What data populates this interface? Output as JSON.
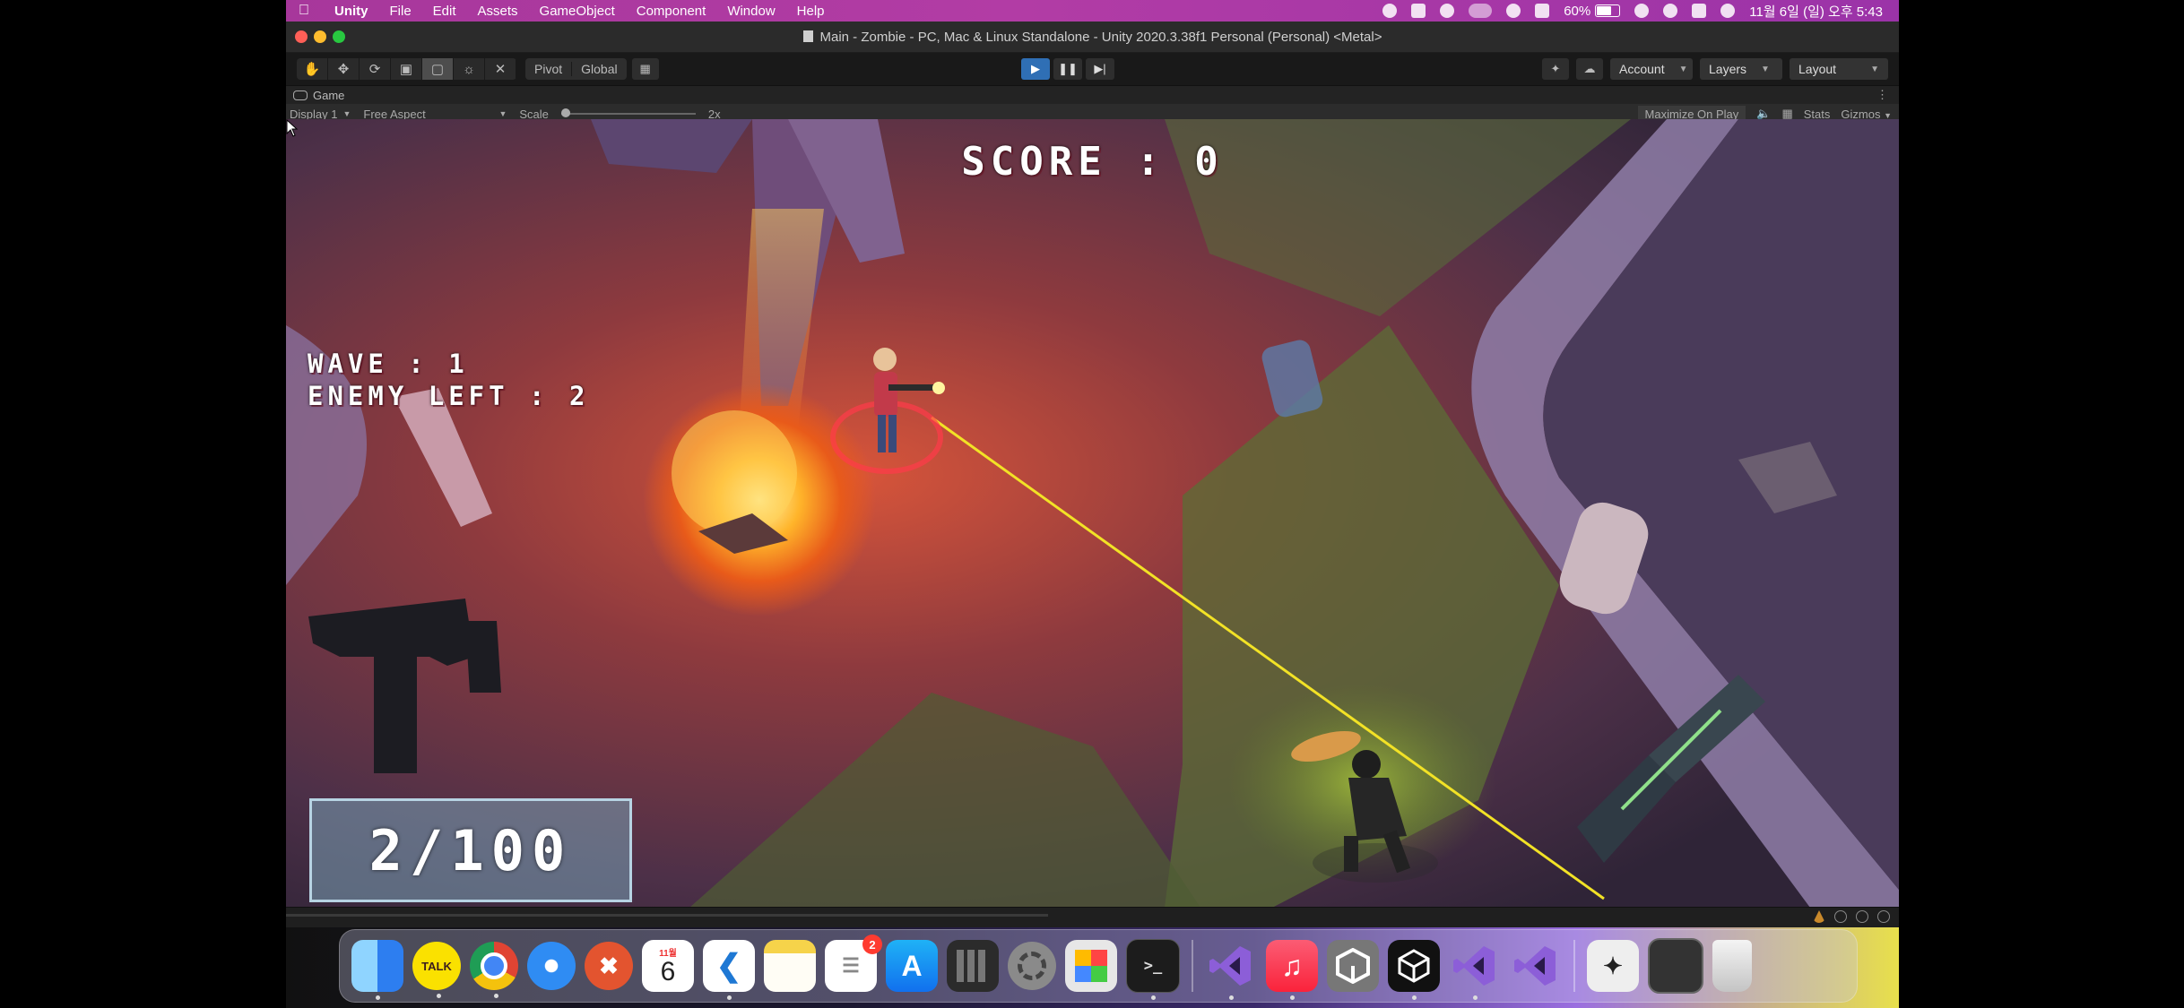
{
  "menubar": {
    "apple": "",
    "items": [
      "Unity",
      "File",
      "Edit",
      "Assets",
      "GameObject",
      "Component",
      "Window",
      "Help"
    ],
    "battery": "60%",
    "datetime": "11월 6일 (일) 오후 5:43",
    "status_icons": [
      "record-icon",
      "unity-icon",
      "creative-cloud-icon",
      "toggle-icon",
      "play-circle-icon",
      "text-input-icon",
      "battery-icon",
      "link-icon",
      "search-icon",
      "control-center-icon",
      "siri-icon"
    ]
  },
  "window": {
    "title": "Main - Zombie - PC, Mac & Linux Standalone - Unity 2020.3.38f1 Personal (Personal) <Metal>"
  },
  "toolbar": {
    "tools": [
      "hand-tool-icon",
      "move-tool-icon",
      "rotate-tool-icon",
      "scale-tool-icon",
      "rect-tool-icon",
      "transform-tool-icon",
      "custom-tool-icon"
    ],
    "pivot": "Pivot",
    "global": "Global",
    "account": "Account",
    "layers": "Layers",
    "layout": "Layout"
  },
  "game_view": {
    "tab_label": "Game",
    "display": "Display 1",
    "aspect": "Free Aspect",
    "scale_label": "Scale",
    "scale_value": "2x",
    "maximize": "Maximize On Play",
    "stats": "Stats",
    "gizmos": "Gizmos"
  },
  "hud": {
    "score": "SCORE : 0",
    "wave": "WAVE : 1",
    "enemy_left": "ENEMY LEFT : 2",
    "ammo": "2/100"
  },
  "dock": {
    "calendar_month": "11월",
    "calendar_day": "6",
    "reminders_badge": "2",
    "talk_label": "TALK"
  },
  "colors": {
    "menubar": "#a7379b",
    "play_active": "#2f6fb5",
    "laser": "#f2e226"
  }
}
